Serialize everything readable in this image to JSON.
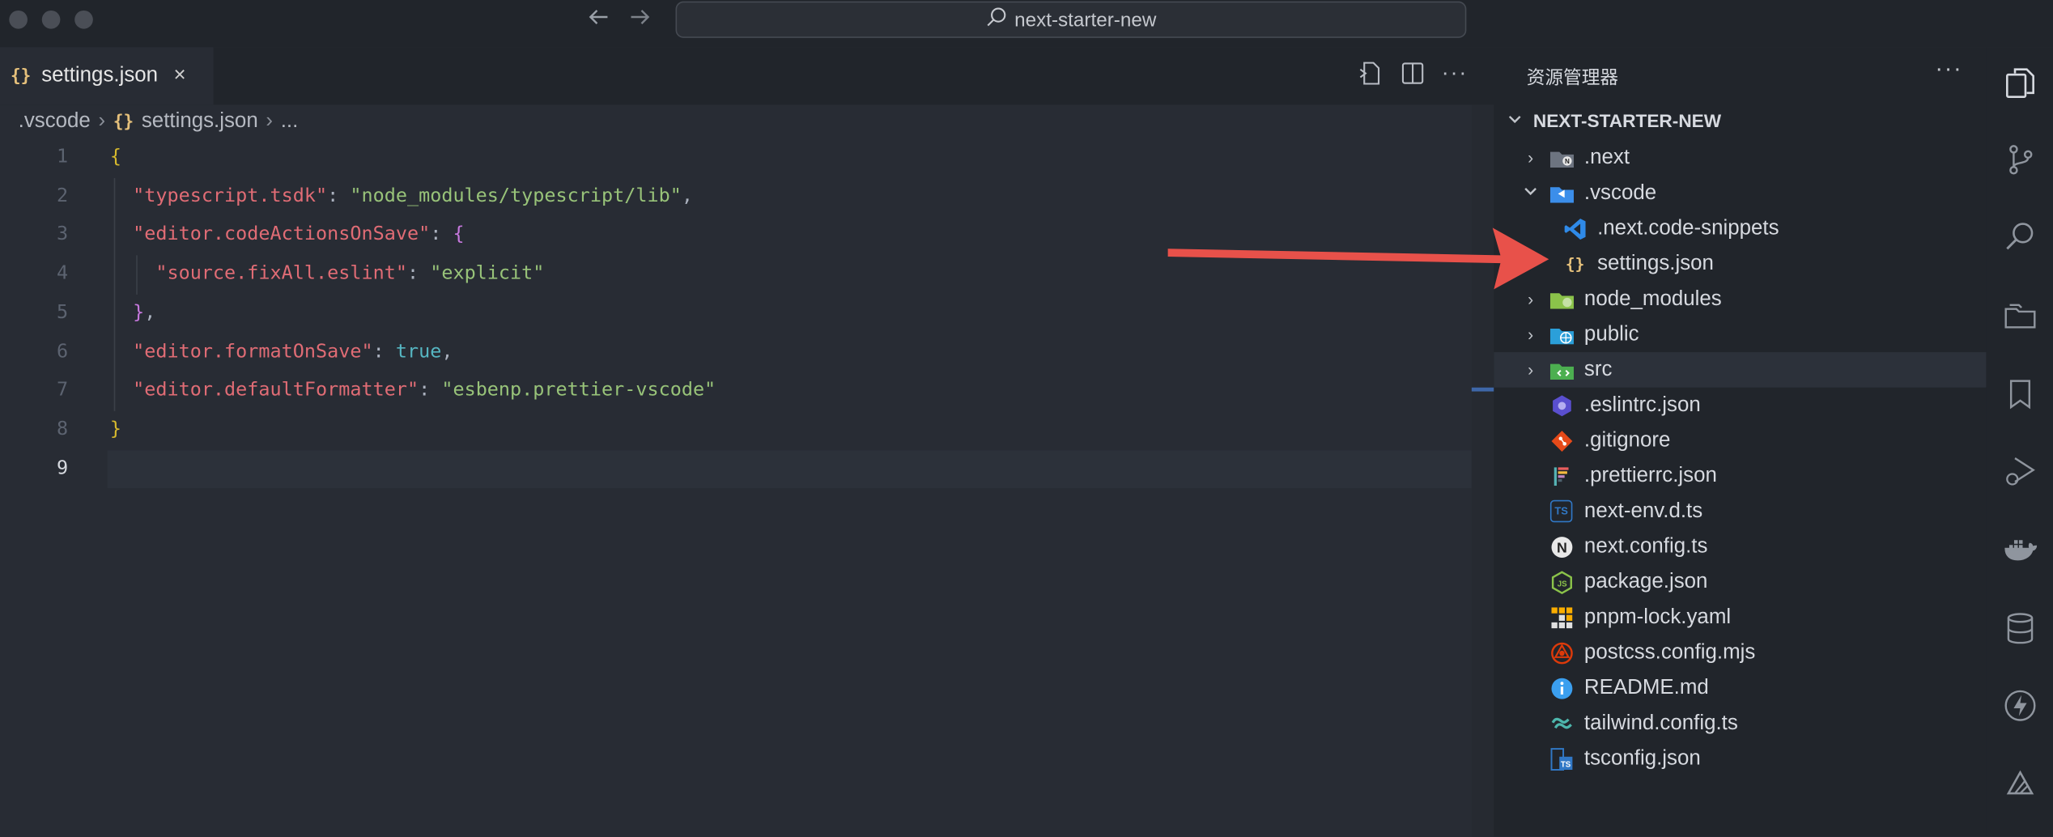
{
  "titlebar": {
    "search_text": "next-starter-new",
    "back_icon": "arrow-left-icon",
    "forward_icon": "arrow-right-icon"
  },
  "tab": {
    "icon": "{}",
    "label": "settings.json",
    "close": "×"
  },
  "breadcrumb": {
    "folder": ".vscode",
    "file_icon": "{}",
    "file": "settings.json",
    "more": "..."
  },
  "editor": {
    "line_numbers": [
      "1",
      "2",
      "3",
      "4",
      "5",
      "6",
      "7",
      "8",
      "9"
    ],
    "current_line": 9
  },
  "explorer": {
    "title": "资源管理器",
    "more": "···",
    "project": "NEXT-STARTER-NEW",
    "items": [
      {
        "label": ".next",
        "icon": "next-folder-icon"
      },
      {
        "label": ".vscode",
        "icon": "vscode-folder-icon"
      },
      {
        "label": ".next.code-snippets",
        "icon": "vscode-icon"
      },
      {
        "label": "settings.json",
        "icon": "json-braces-icon"
      },
      {
        "label": "node_modules",
        "icon": "node-folder-icon"
      },
      {
        "label": "public",
        "icon": "public-folder-icon"
      },
      {
        "label": "src",
        "icon": "src-folder-icon"
      },
      {
        "label": ".eslintrc.json",
        "icon": "eslint-icon"
      },
      {
        "label": ".gitignore",
        "icon": "git-icon"
      },
      {
        "label": ".prettierrc.json",
        "icon": "prettier-icon"
      },
      {
        "label": "next-env.d.ts",
        "icon": "typescript-def-icon"
      },
      {
        "label": "next.config.ts",
        "icon": "nextjs-icon"
      },
      {
        "label": "package.json",
        "icon": "nodejs-icon"
      },
      {
        "label": "pnpm-lock.yaml",
        "icon": "pnpm-icon"
      },
      {
        "label": "postcss.config.mjs",
        "icon": "postcss-icon"
      },
      {
        "label": "README.md",
        "icon": "info-icon"
      },
      {
        "label": "tailwind.config.ts",
        "icon": "tailwind-icon"
      },
      {
        "label": "tsconfig.json",
        "icon": "tsconfig-icon"
      }
    ]
  },
  "activity_bar": [
    "explorer-icon",
    "source-control-icon",
    "search-icon",
    "folders-icon",
    "bookmark-icon",
    "run-debug-icon",
    "docker-icon",
    "database-icon",
    "lightning-icon",
    "extensions-icon"
  ],
  "colors": {
    "key": "#e06c75",
    "string": "#98c379",
    "boolean": "#56b6c2",
    "brace": "#d7ba2d",
    "arrow": "#e8514a"
  }
}
